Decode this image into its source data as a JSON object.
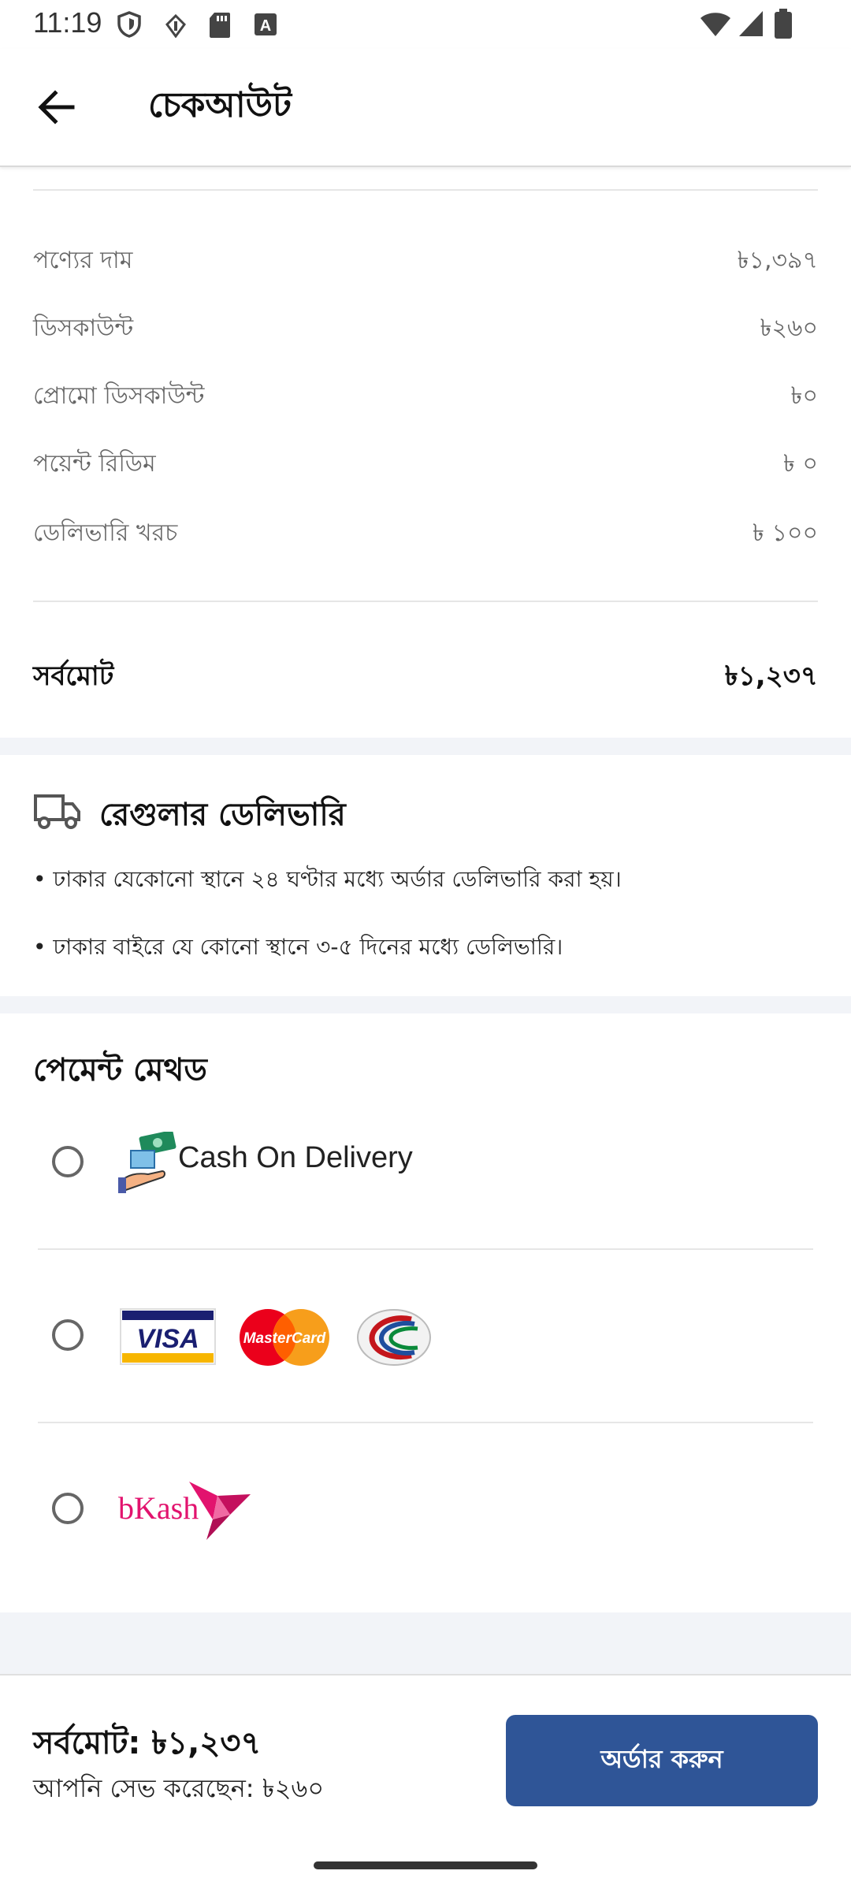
{
  "status_bar": {
    "time": "11:19",
    "icons": [
      "shield-icon",
      "data-saver-icon",
      "sd-card-icon",
      "keyboard-a-icon",
      "wifi-icon",
      "signal-icon",
      "battery-icon"
    ]
  },
  "app_bar": {
    "title": "চেকআউট",
    "back_icon": "arrow-left-icon"
  },
  "summary": {
    "rows": [
      {
        "label": "পণ্যের দাম",
        "value": "৳১,৩৯৭"
      },
      {
        "label": "ডিসকাউন্ট",
        "value": "৳২৬০"
      },
      {
        "label": "প্রোমো ডিসকাউন্ট",
        "value": "৳০"
      },
      {
        "label": "পয়েন্ট রিডিম",
        "value": "৳ ০"
      },
      {
        "label": "ডেলিভারি খরচ",
        "value": "৳ ১০০"
      }
    ],
    "total_label": "সর্বমোট",
    "total_value": "৳১,২৩৭"
  },
  "delivery": {
    "icon": "truck-icon",
    "title": "রেগুলার ডেলিভারি",
    "lines": [
      "• ঢাকার যেকোনো স্থানে ২৪ ঘণ্টার মধ্যে অর্ডার ডেলিভারি করা হয়।",
      "• ঢাকার বাইরে যে কোনো স্থানে ৩-৫ দিনের মধ্যে ডেলিভারি।"
    ]
  },
  "payment": {
    "title": "পেমেন্ট মেথড",
    "options": [
      {
        "label": "Cash On Delivery",
        "icon": "cash-on-delivery-icon",
        "selected": false
      },
      {
        "logos": [
          "VISA",
          "MasterCard",
          "dbbl-nexus-icon"
        ],
        "selected": false
      },
      {
        "label": "bKash",
        "icon": "bkash-bird-icon",
        "selected": false
      }
    ]
  },
  "bottom_bar": {
    "total_text": "সর্বমোট: ৳১,২৩৭",
    "saved_text": "আপনি সেভ করেছেন: ৳২৬০",
    "order_button": "অর্ডার করুন"
  },
  "colors": {
    "primary": "#2f5597",
    "section_gap": "#f2f4f8",
    "muted_text": "#666666",
    "bkash_pink": "#e2136e"
  }
}
